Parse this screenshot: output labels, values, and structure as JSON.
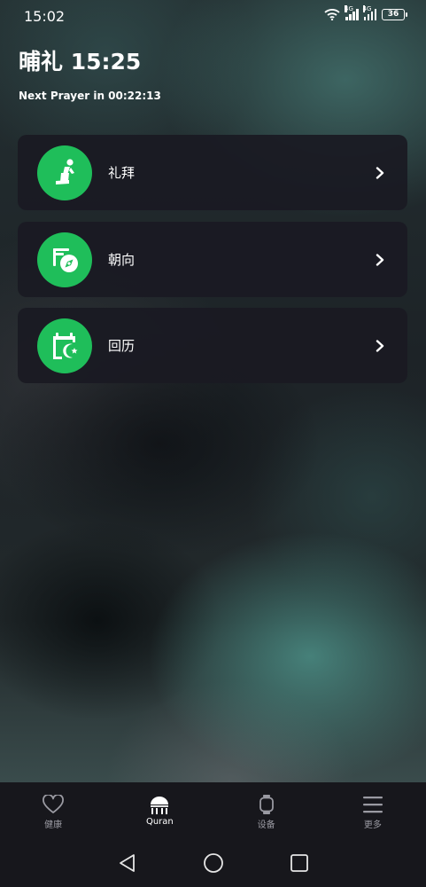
{
  "status_bar": {
    "time": "15:02",
    "network_type_1": "4G",
    "network_type_2": "4G",
    "battery_level": "36"
  },
  "header": {
    "title": "晡礼 15:25",
    "next_prayer": "Next Prayer in 00:22:13"
  },
  "menu": [
    {
      "label": "礼拜",
      "icon": "prayer-person-icon"
    },
    {
      "label": "朝向",
      "icon": "qibla-compass-icon"
    },
    {
      "label": "回历",
      "icon": "hijri-calendar-icon"
    }
  ],
  "bottom_nav": [
    {
      "label": "健康",
      "icon": "heart-icon",
      "active": false
    },
    {
      "label": "Quran",
      "icon": "mosque-icon",
      "active": true
    },
    {
      "label": "设备",
      "icon": "watch-icon",
      "active": false
    },
    {
      "label": "更多",
      "icon": "menu-icon",
      "active": false
    }
  ],
  "colors": {
    "accent": "#1fbe5a",
    "card_bg": "#1a1a22",
    "nav_bg": "#17171c",
    "inactive_text": "#9a9aa2"
  }
}
